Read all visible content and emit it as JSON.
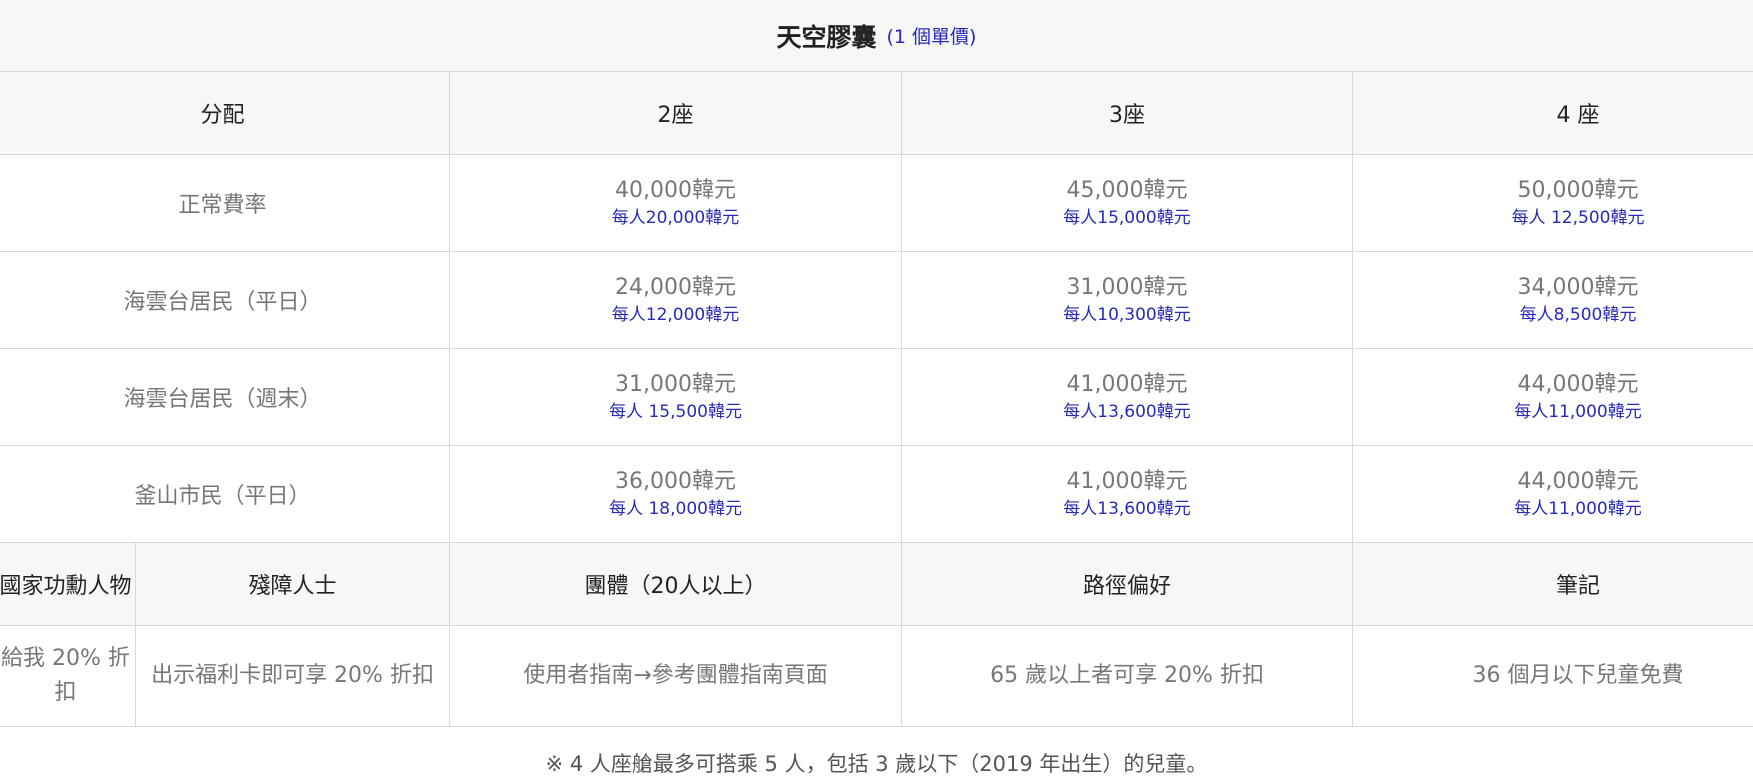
{
  "title": "天空膠囊",
  "title_note": "(1 個單價)",
  "header": {
    "category": "分配",
    "seats": [
      "2座",
      "3座",
      "4 座"
    ]
  },
  "rows": [
    {
      "label": "正常費率",
      "cells": [
        {
          "price": "40,000韓元",
          "per": "每人20,000韓元"
        },
        {
          "price": "45,000韓元",
          "per": "每人15,000韓元"
        },
        {
          "price": "50,000韓元",
          "per": "每人 12,500韓元"
        }
      ]
    },
    {
      "label": "海雲台居民（平日）",
      "cells": [
        {
          "price": "24,000韓元",
          "per": "每人12,000韓元"
        },
        {
          "price": "31,000韓元",
          "per": "每人10,300韓元"
        },
        {
          "price": "34,000韓元",
          "per": "每人8,500韓元"
        }
      ]
    },
    {
      "label": "海雲台居民（週末）",
      "cells": [
        {
          "price": "31,000韓元",
          "per": "每人 15,500韓元"
        },
        {
          "price": "41,000韓元",
          "per": "每人13,600韓元"
        },
        {
          "price": "44,000韓元",
          "per": "每人11,000韓元"
        }
      ]
    },
    {
      "label": "釜山市民（平日）",
      "cells": [
        {
          "price": "36,000韓元",
          "per": "每人 18,000韓元"
        },
        {
          "price": "41,000韓元",
          "per": "每人13,600韓元"
        },
        {
          "price": "44,000韓元",
          "per": "每人11,000韓元"
        }
      ]
    }
  ],
  "discount_header": [
    "國家功勳人物",
    "殘障人士",
    "團體（20人以上）",
    "路徑偏好",
    "筆記"
  ],
  "discount_values": [
    "給我 20% 折扣",
    "出示福利卡即可享 20% 折扣",
    "使用者指南→參考團體指南頁面",
    "65 歲以上者可享 20% 折扣",
    "36 個月以下兒童免費"
  ],
  "footnote": "※ 4 人座艙最多可搭乘 5 人，包括 3 歲以下（2019 年出生）的兒童。"
}
